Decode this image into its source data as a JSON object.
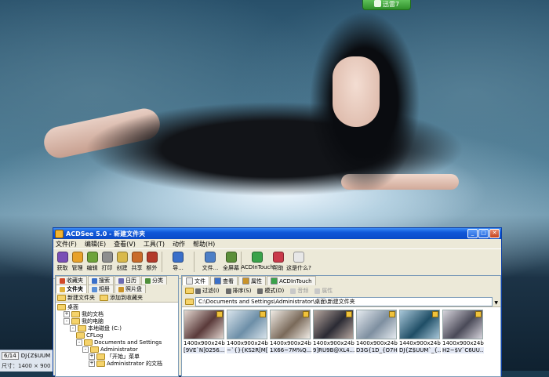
{
  "desktop": {
    "badge_label": "迅雷7"
  },
  "background_window": {
    "page": "6/14",
    "file_text": "DJ{Z$UUM",
    "dimensions_text": "尺寸：1400 × 900 像"
  },
  "window": {
    "title": "ACDSee 5.0 - 新建文件夹",
    "controls": [
      "_",
      "□",
      "✕"
    ]
  },
  "menubar": [
    "文件(F)",
    "编辑(E)",
    "查看(V)",
    "工具(T)",
    "动作",
    "帮助(H)"
  ],
  "toolbar": [
    {
      "label": "获取",
      "color": "#7a4fb6"
    },
    {
      "label": "管理",
      "color": "#e8a22a"
    },
    {
      "label": "编辑",
      "color": "#6ea33a"
    },
    {
      "label": "打印",
      "color": "#8e8e8e"
    },
    {
      "label": "创建",
      "color": "#d9b94b"
    },
    {
      "label": "共享",
      "color": "#c96b2a"
    },
    {
      "label": "额外",
      "color": "#b33a2a"
    },
    {
      "label": "导...",
      "color": "#3a6fc9"
    },
    {
      "label": "文件...",
      "color": "#4d7fc6"
    },
    {
      "label": "全屏幕",
      "color": "#5c8f3a"
    },
    {
      "label": "ACDInTouch",
      "color": "#3aa24a"
    },
    {
      "label": "帮助",
      "color": "#c93a4a"
    },
    {
      "label": "这是什么?",
      "color": "#e7e7e7"
    }
  ],
  "left_pane": {
    "tabs_top": [
      "收藏夹",
      "搜索",
      "日历",
      "分类"
    ],
    "tabs_bottom": [
      "文件夹",
      "相册",
      "照片盘"
    ],
    "tools": [
      "新建文件夹",
      "添加到收藏夹"
    ],
    "tree": [
      {
        "label": "桌面",
        "level": 0,
        "exp": ""
      },
      {
        "label": "我的文档",
        "level": 1,
        "exp": "+"
      },
      {
        "label": "我的电脑",
        "level": 1,
        "exp": "-"
      },
      {
        "label": "本地磁盘 (C:)",
        "level": 2,
        "exp": "-"
      },
      {
        "label": "CFLog",
        "level": 3,
        "exp": ""
      },
      {
        "label": "Documents and Settings",
        "level": 3,
        "exp": "-"
      },
      {
        "label": "Administrator",
        "level": 4,
        "exp": "-"
      },
      {
        "label": "「开始」菜单",
        "level": 5,
        "exp": "+"
      },
      {
        "label": "Administrator 的文档",
        "level": 5,
        "exp": "+"
      }
    ]
  },
  "right_pane": {
    "tabs": [
      "文件",
      "查看",
      "属性",
      "ACDInTouch"
    ],
    "tools": [
      {
        "label": "过滤(I)",
        "dim": false
      },
      {
        "label": "排序(S)",
        "dim": false
      },
      {
        "label": "模式(D)",
        "dim": false
      },
      {
        "label": "音频",
        "dim": true
      },
      {
        "label": "属性",
        "dim": true
      }
    ],
    "address": "C:\\Documents and Settings\\Administrator\\桌面\\新建文件夹",
    "thumbnails": [
      {
        "size": "1400x900x24b",
        "name": "[9VE`N]0256...",
        "c1": "#5a3a3a",
        "c2": "#e3d7d0"
      },
      {
        "size": "1400x900x24b",
        "name": "~`{}{KS2R[M[...",
        "c1": "#6d8fa8",
        "c2": "#d9e4ec"
      },
      {
        "size": "1400x900x24b",
        "name": "1X66~7M%Q...",
        "c1": "#7a6a5a",
        "c2": "#f1ece6"
      },
      {
        "size": "1400x900x24b",
        "name": "9]RU9B@XL4...",
        "c1": "#2b2b34",
        "c2": "#b8a8a0"
      },
      {
        "size": "1400x900x24b",
        "name": "D3G{1D_{O7H...",
        "c1": "#7e8fa0",
        "c2": "#e6ebf0"
      },
      {
        "size": "1440x900x24b",
        "name": "DJ{Z$UUM`_{...",
        "c1": "#1f4e66",
        "c2": "#a7c6d8"
      },
      {
        "size": "1400x900x24b",
        "name": "H2~$V`C6UU...",
        "c1": "#4a4a58",
        "c2": "#d7d4dc"
      }
    ]
  }
}
